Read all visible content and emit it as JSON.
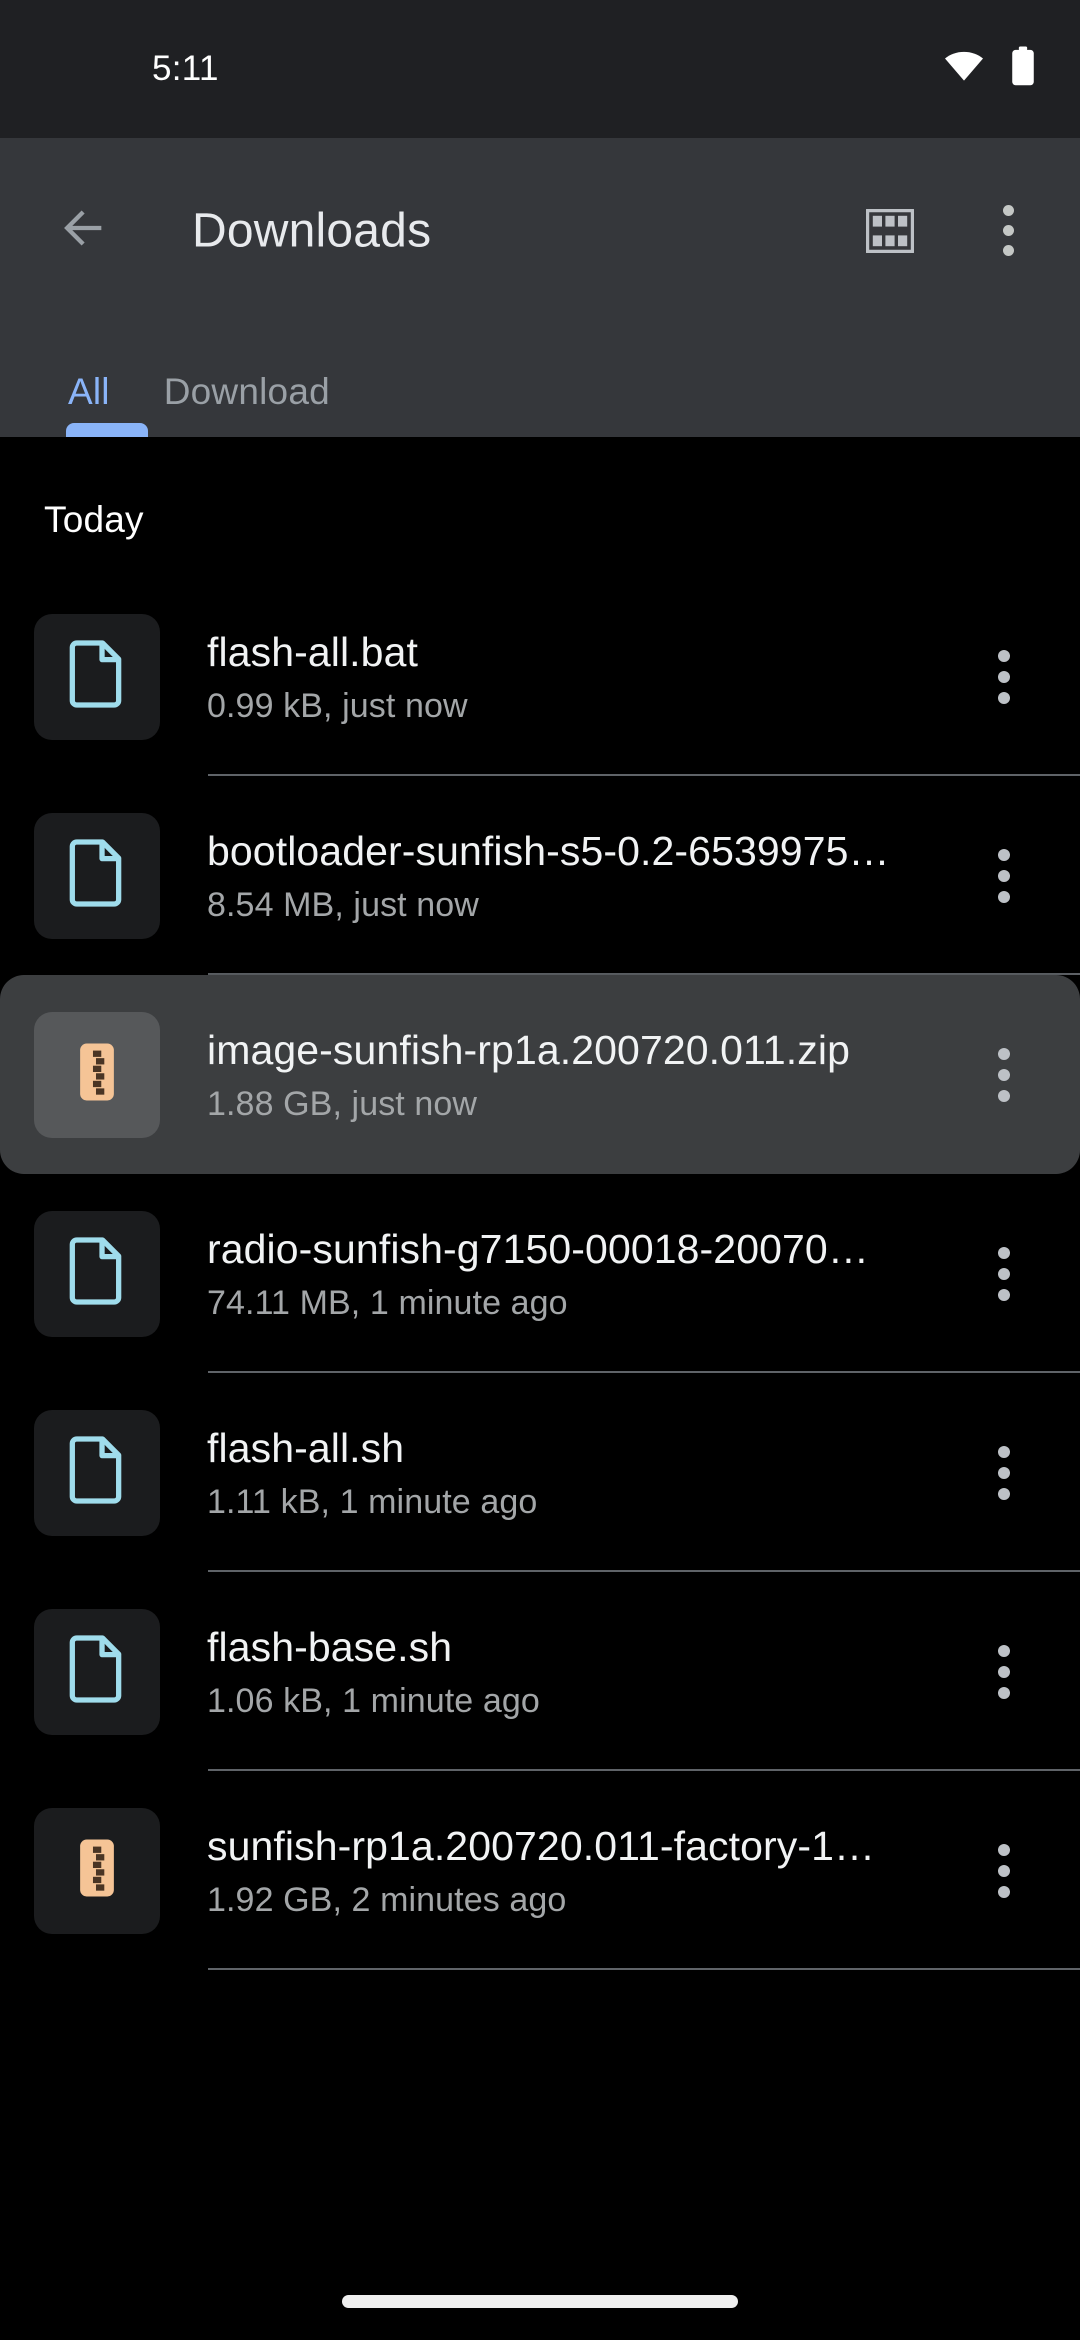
{
  "status_bar": {
    "time": "5:11",
    "wifi_icon": "wifi-icon",
    "battery_icon": "battery-full-icon"
  },
  "app_bar": {
    "back_icon": "back-arrow-icon",
    "title": "Downloads",
    "grid_view_icon": "grid-view-icon",
    "overflow_icon": "overflow-menu-icon"
  },
  "tabs": {
    "items": [
      {
        "label": "All",
        "active": true
      },
      {
        "label": "Download",
        "active": false
      }
    ],
    "active_color": "#8AB4F8",
    "inactive_color": "#9AA0A6"
  },
  "content": {
    "section_header": "Today",
    "files": [
      {
        "name": "flash-all.bat",
        "meta": "0.99 kB, just now",
        "icon": "document-file-icon",
        "icon_color": "#9FDCEC",
        "selected": false,
        "menu_icon": "overflow-menu-icon"
      },
      {
        "name": "bootloader-sunfish-s5-0.2-6539975…",
        "meta": "8.54 MB, just now",
        "icon": "document-file-icon",
        "icon_color": "#9FDCEC",
        "selected": false,
        "menu_icon": "overflow-menu-icon"
      },
      {
        "name": "image-sunfish-rp1a.200720.011.zip",
        "meta": "1.88 GB, just now",
        "icon": "zip-archive-icon",
        "icon_color": "#F5C496",
        "selected": true,
        "menu_icon": "overflow-menu-icon"
      },
      {
        "name": "radio-sunfish-g7150-00018-20070…",
        "meta": "74.11 MB, 1 minute ago",
        "icon": "document-file-icon",
        "icon_color": "#9FDCEC",
        "selected": false,
        "menu_icon": "overflow-menu-icon"
      },
      {
        "name": "flash-all.sh",
        "meta": "1.11 kB, 1 minute ago",
        "icon": "document-file-icon",
        "icon_color": "#9FDCEC",
        "selected": false,
        "menu_icon": "overflow-menu-icon"
      },
      {
        "name": "flash-base.sh",
        "meta": "1.06 kB, 1 minute ago",
        "icon": "document-file-icon",
        "icon_color": "#9FDCEC",
        "selected": false,
        "menu_icon": "overflow-menu-icon"
      },
      {
        "name": "sunfish-rp1a.200720.011-factory-1…",
        "meta": "1.92 GB, 2 minutes ago",
        "icon": "zip-archive-icon",
        "icon_color": "#F5C496",
        "selected": false,
        "menu_icon": "overflow-menu-icon"
      }
    ]
  },
  "nav_bar": {
    "gesture_pill": "home-gesture-pill"
  },
  "colors": {
    "status_bar_bg": "#1F2023",
    "app_bar_bg": "#35373B",
    "content_bg": "#000000",
    "selected_row_bg": "#3C3E40",
    "divider": "#5F6368",
    "title_text": "#F1F3F4",
    "meta_text": "#A3A6A8"
  }
}
